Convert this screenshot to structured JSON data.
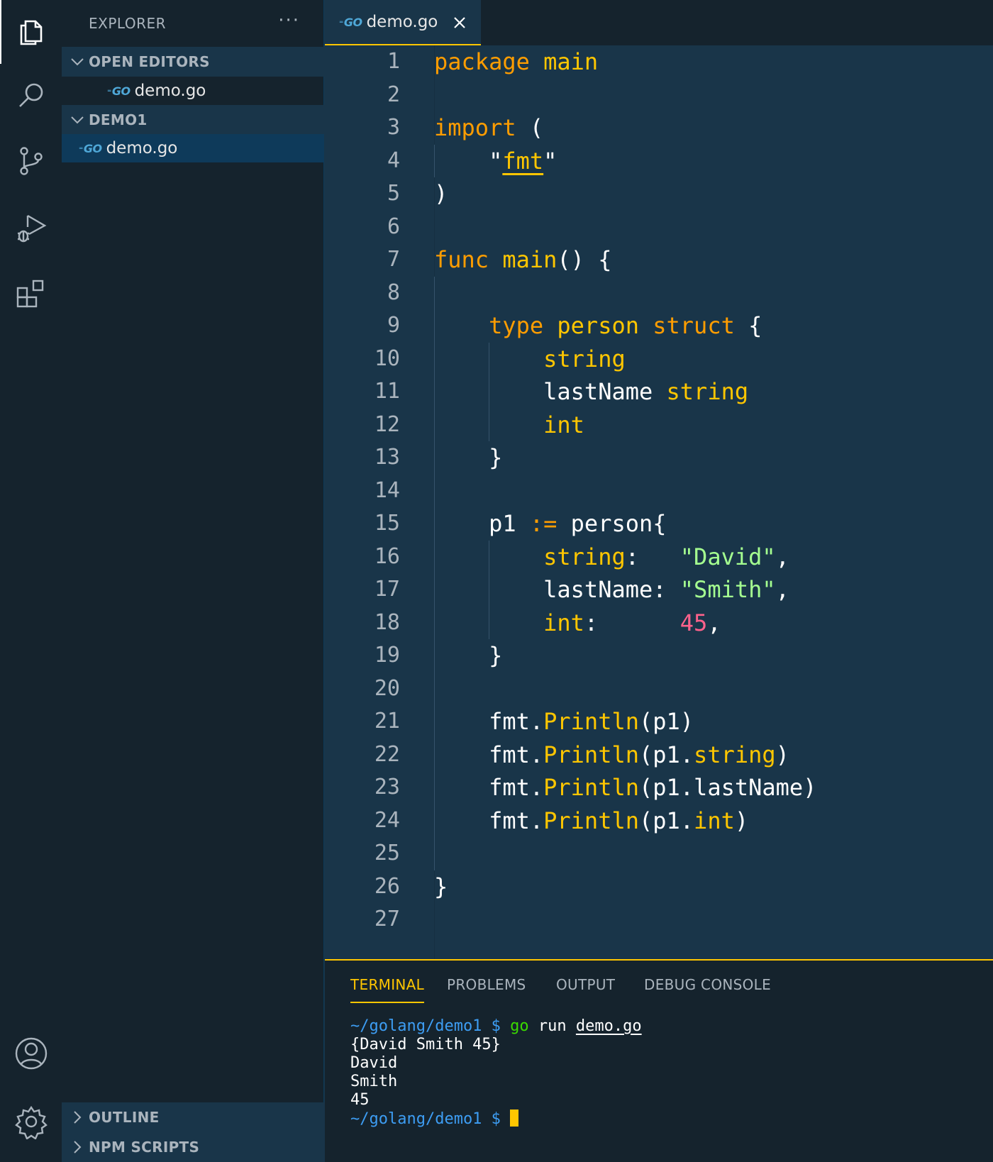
{
  "colors": {
    "accent": "#ffc600",
    "background": "#193549",
    "sidebar": "#15232d"
  },
  "activity_bar": {
    "icons": [
      "files-icon",
      "search-icon",
      "source-control-icon",
      "run-debug-icon",
      "extensions-icon",
      "account-icon",
      "gear-icon"
    ]
  },
  "sidebar": {
    "title": "EXPLORER",
    "more": "···",
    "open_editors": {
      "label": "OPEN EDITORS",
      "files": [
        {
          "badge": "GO",
          "name": "demo.go"
        }
      ]
    },
    "demo1": {
      "label": "DEMO1",
      "files": [
        {
          "badge": "GO",
          "name": "demo.go"
        }
      ]
    },
    "outline": {
      "label": "OUTLINE"
    },
    "npm_scripts": {
      "label": "NPM SCRIPTS"
    }
  },
  "tab": {
    "badge": "GO",
    "name": "demo.go"
  },
  "editor": {
    "line_numbers": [
      "1",
      "2",
      "3",
      "4",
      "5",
      "6",
      "7",
      "8",
      "9",
      "10",
      "11",
      "12",
      "13",
      "14",
      "15",
      "16",
      "17",
      "18",
      "19",
      "20",
      "21",
      "22",
      "23",
      "24",
      "25",
      "26",
      "27"
    ],
    "lines": [
      [
        {
          "t": "package",
          "c": "kw"
        },
        {
          "t": " "
        },
        {
          "t": "main",
          "c": "ty"
        }
      ],
      [],
      [
        {
          "t": "import",
          "c": "kw"
        },
        {
          "t": " ("
        }
      ],
      [
        {
          "t": "    \""
        },
        {
          "t": "fmt",
          "c": "ty",
          "u": true
        },
        {
          "t": "\""
        }
      ],
      [
        {
          "t": ")"
        }
      ],
      [],
      [
        {
          "t": "func",
          "c": "kw"
        },
        {
          "t": " "
        },
        {
          "t": "main",
          "c": "fn"
        },
        {
          "t": "() {"
        }
      ],
      [],
      [
        {
          "t": "    "
        },
        {
          "t": "type",
          "c": "kw"
        },
        {
          "t": " "
        },
        {
          "t": "person",
          "c": "ty"
        },
        {
          "t": " "
        },
        {
          "t": "struct",
          "c": "kw"
        },
        {
          "t": " {"
        }
      ],
      [
        {
          "t": "        "
        },
        {
          "t": "string",
          "c": "ty"
        }
      ],
      [
        {
          "t": "        lastName "
        },
        {
          "t": "string",
          "c": "ty"
        }
      ],
      [
        {
          "t": "        "
        },
        {
          "t": "int",
          "c": "ty"
        }
      ],
      [
        {
          "t": "    }"
        }
      ],
      [],
      [
        {
          "t": "    p1 "
        },
        {
          "t": ":=",
          "c": "op"
        },
        {
          "t": " person{"
        }
      ],
      [
        {
          "t": "        "
        },
        {
          "t": "string",
          "c": "ty"
        },
        {
          "t": ":   "
        },
        {
          "t": "\"David\"",
          "c": "str"
        },
        {
          "t": ","
        }
      ],
      [
        {
          "t": "        lastName: "
        },
        {
          "t": "\"Smith\"",
          "c": "str"
        },
        {
          "t": ","
        }
      ],
      [
        {
          "t": "        "
        },
        {
          "t": "int",
          "c": "ty"
        },
        {
          "t": ":      "
        },
        {
          "t": "45",
          "c": "num"
        },
        {
          "t": ","
        }
      ],
      [
        {
          "t": "    }"
        }
      ],
      [],
      [
        {
          "t": "    fmt."
        },
        {
          "t": "Println",
          "c": "fn"
        },
        {
          "t": "(p1)"
        }
      ],
      [
        {
          "t": "    fmt."
        },
        {
          "t": "Println",
          "c": "fn"
        },
        {
          "t": "(p1."
        },
        {
          "t": "string",
          "c": "ty"
        },
        {
          "t": ")"
        }
      ],
      [
        {
          "t": "    fmt."
        },
        {
          "t": "Println",
          "c": "fn"
        },
        {
          "t": "(p1.lastName)"
        }
      ],
      [
        {
          "t": "    fmt."
        },
        {
          "t": "Println",
          "c": "fn"
        },
        {
          "t": "(p1."
        },
        {
          "t": "int",
          "c": "ty"
        },
        {
          "t": ")"
        }
      ],
      [],
      [
        {
          "t": "}"
        }
      ],
      []
    ]
  },
  "panel": {
    "tabs": [
      "TERMINAL",
      "PROBLEMS",
      "OUTPUT",
      "DEBUG CONSOLE"
    ],
    "terminal": {
      "prompt_path": "~/golang/demo1 $",
      "command": "go",
      "command_args_pre": " run ",
      "command_file": "demo.go",
      "output": [
        "{David Smith 45}",
        "David",
        "Smith",
        "45"
      ],
      "final_prompt": "~/golang/demo1 $"
    }
  }
}
